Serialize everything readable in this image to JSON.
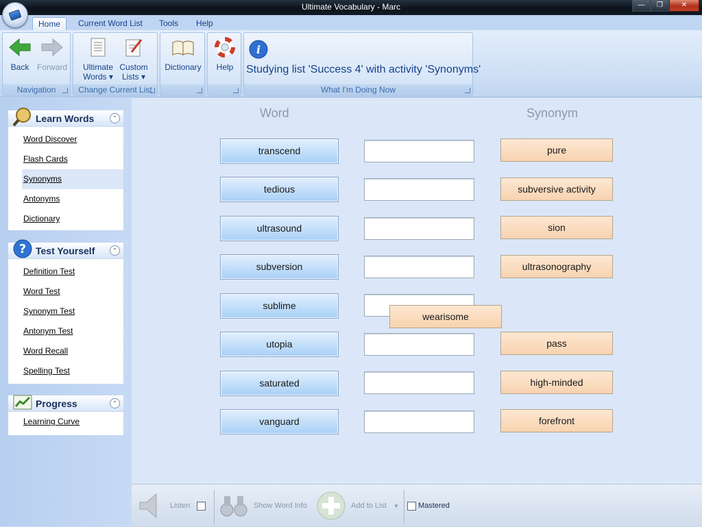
{
  "window": {
    "title": "Ultimate Vocabulary - Marc"
  },
  "tabs": [
    {
      "label": "Home",
      "active": true
    },
    {
      "label": "Current Word List"
    },
    {
      "label": "Tools"
    },
    {
      "label": "Help"
    }
  ],
  "ribbon": {
    "navigation": {
      "label": "Navigation",
      "back": "Back",
      "forward": "Forward"
    },
    "change_list": {
      "label": "Change Current List",
      "ultimate_words_1": "Ultimate",
      "ultimate_words_2": "Words",
      "custom_lists_1": "Custom",
      "custom_lists_2": "Lists"
    },
    "dictionary": {
      "label": "Dictionary"
    },
    "help": {
      "label": "Help"
    },
    "what_doing": {
      "label": "What I'm Doing Now",
      "status": "Studying list 'Success 4' with activity 'Synonyms'"
    }
  },
  "sidebar": {
    "learn": {
      "title": "Learn Words",
      "items": [
        "Word Discover",
        "Flash Cards",
        "Synonyms",
        "Antonyms",
        "Dictionary"
      ]
    },
    "test": {
      "title": "Test Yourself",
      "items": [
        "Definition Test",
        "Word Test",
        "Synonym Test",
        "Antonym Test",
        "Word Recall",
        "Spelling Test"
      ]
    },
    "progress": {
      "title": "Progress",
      "items": [
        "Learning Curve"
      ]
    }
  },
  "activity": {
    "word_header": "Word",
    "synonym_header": "Synonym",
    "words": [
      "transcend",
      "tedious",
      "ultrasound",
      "subversion",
      "sublime",
      "utopia",
      "saturated",
      "vanguard"
    ],
    "synonyms": [
      "pure",
      "subversive activity",
      "sion",
      "ultrasonography",
      "",
      "pass",
      "high-minded",
      "forefront"
    ],
    "dragging": "wearisome"
  },
  "toolbar": {
    "listen": "Listen",
    "show_word_info": "Show Word Info",
    "add_to_list": "Add to List",
    "mastered": "Mastered"
  },
  "colors": {
    "word_button": "#b9daf9",
    "synonym_button": "#fadcc0",
    "content_bg": "#dbe7f8"
  }
}
